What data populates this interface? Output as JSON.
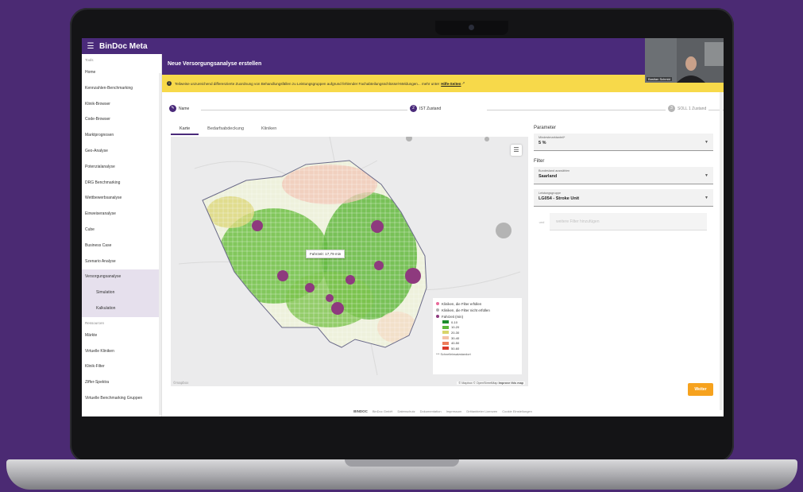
{
  "app": {
    "title": "BinDoc Meta"
  },
  "sidebar": {
    "sections": [
      {
        "label": "Tools"
      },
      {
        "label": "Ressourcen"
      }
    ],
    "tools": [
      {
        "label": "Home"
      },
      {
        "label": "Kennzahlen-Benchmarking"
      },
      {
        "label": "Klinik-Browser"
      },
      {
        "label": "Code-Browser"
      },
      {
        "label": "Marktprognosen"
      },
      {
        "label": "Geo-Analyse"
      },
      {
        "label": "Potenzialanalyse"
      },
      {
        "label": "DRG Benchmarking"
      },
      {
        "label": "Wettbewerbsanalyse"
      },
      {
        "label": "Einweiseranalyse"
      },
      {
        "label": "Cube"
      },
      {
        "label": "Business Case"
      },
      {
        "label": "Szenario Analyse"
      },
      {
        "label": "Versorgungsanalyse"
      },
      {
        "label": "Simulation"
      },
      {
        "label": "Kalkulation"
      }
    ],
    "resources": [
      {
        "label": "Märkte"
      },
      {
        "label": "Virtuelle Kliniken"
      },
      {
        "label": "Klinik-Filter"
      },
      {
        "label": "Ziffer-Spektra"
      },
      {
        "label": "Virtuelle Benchmarking Gruppen"
      }
    ]
  },
  "page": {
    "title": "Neue Versorgungsanalyse erstellen"
  },
  "banner": {
    "text": "Teilweise unzureichend differenzierte Zuordnung von Behandlungsfällen zu Leistungsgruppen aufgrund fehlender Fachabteilungsschlüssel-Meldungen... mehr unter",
    "link": "Hilfe-Seiten"
  },
  "stepper": {
    "steps": [
      {
        "number": "",
        "label": "Name"
      },
      {
        "number": "2",
        "label": "IST Zustand"
      },
      {
        "number": "3",
        "label": "SOLL 1 Zustand"
      }
    ]
  },
  "tabs": [
    {
      "label": "Karte"
    },
    {
      "label": "Bedarfsabdeckung"
    },
    {
      "label": "Kliniken"
    }
  ],
  "map": {
    "tooltip": "Fahrzeit: 17,79 min",
    "legend": {
      "items": [
        {
          "label": "Kliniken, die Filter erfüllen",
          "color": "#e96a9a"
        },
        {
          "label": "Kliniken, die Filter nicht erfüllen",
          "color": "#b0b0b0"
        },
        {
          "label": "Fahrzeit (min)",
          "color": "#8e3a7e"
        }
      ],
      "scale": [
        {
          "label": "0-10",
          "color": "#1b8c2c"
        },
        {
          "label": "10-20",
          "color": "#5bb83a"
        },
        {
          "label": "20-30",
          "color": "#d8d56a"
        },
        {
          "label": "30-40",
          "color": "#f4c2a8"
        },
        {
          "label": "40-50",
          "color": "#ee7d5a"
        },
        {
          "label": "50-60",
          "color": "#d93a2b"
        }
      ],
      "footnote": "*** Schnelleinsatzstandort"
    },
    "attribution": "© Mapbox © OpenStreetMap",
    "improve_link": "Improve this map",
    "logo": "©mapbox"
  },
  "parameters": {
    "title": "Parameter",
    "fields": [
      {
        "label": "Mindestmarktanteil*",
        "value": "5 %"
      }
    ]
  },
  "filter": {
    "title": "Filter",
    "fields": [
      {
        "label": "Bundesland auswählen",
        "value": "Saarland"
      },
      {
        "label": "Leistungsgruppe",
        "value": "LG054 - Stroke Unit"
      }
    ],
    "extra": {
      "icon_text": "und",
      "placeholder": "weitere Filter hinzufügen"
    }
  },
  "actions": {
    "next": "Weiter"
  },
  "footer": {
    "logo": "BINDOC",
    "links": [
      "BinDoc GmbH",
      "Datenschutz",
      "Dokumentation",
      "Impressum",
      "Drittanbieter Lizenzen",
      "Cookie Einstellungen"
    ]
  },
  "video": {
    "name": "Bastian Schmid"
  },
  "colors": {
    "brand": "#4a2a7a",
    "warning": "#f7d94a",
    "accent": "#f6a21e",
    "frame": "#4b2a73"
  }
}
